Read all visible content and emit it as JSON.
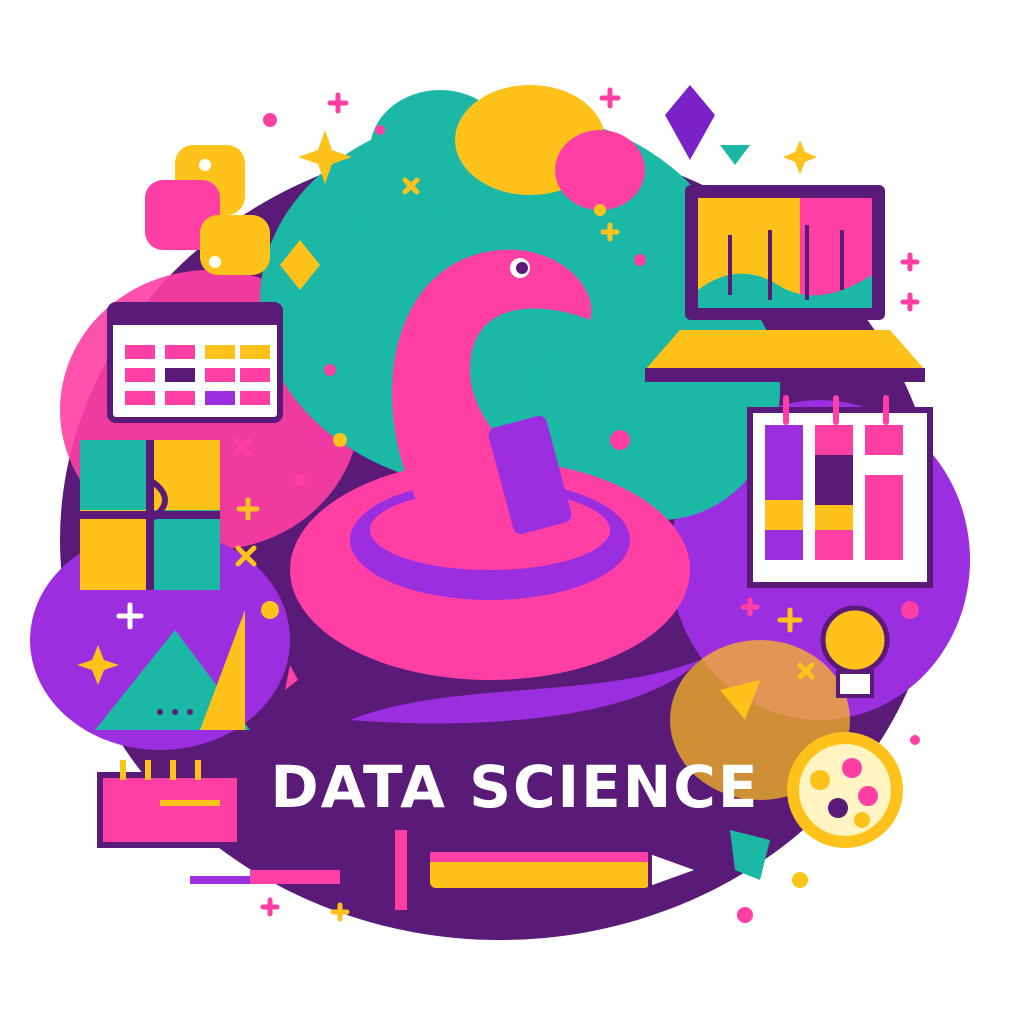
{
  "title": "DATA SCIENCE",
  "colors": {
    "pink": "#ff3fa4",
    "purple": "#5a1a78",
    "violet": "#9b2fe0",
    "teal": "#1bb8a6",
    "yellow": "#ffc21a",
    "white": "#ffffff"
  },
  "icons": [
    "python-logo-icon",
    "snake-icon",
    "laptop-chart-icon",
    "calendar-table-icon",
    "bar-chart-board-icon",
    "puzzle-tile-icon",
    "triangle-ruler-icon",
    "lightbulb-icon",
    "notebook-icon",
    "pencil-icon",
    "syringe-icon",
    "petri-dish-icon",
    "crystal-gem-icon",
    "sparkle-icon",
    "plus-icon",
    "cross-icon"
  ]
}
